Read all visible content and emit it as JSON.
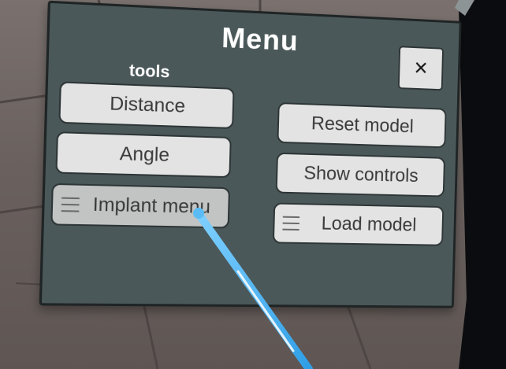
{
  "menu": {
    "title": "Menu",
    "close_label": "✕",
    "tools_label": "tools",
    "left_buttons": [
      {
        "label": "Distance"
      },
      {
        "label": "Angle"
      },
      {
        "label": "Implant menu"
      }
    ],
    "right_buttons": [
      {
        "label": "Reset model"
      },
      {
        "label": "Show controls"
      },
      {
        "label": "Load model"
      }
    ]
  },
  "icons": {
    "submenu": "hamburger-icon",
    "close": "close-icon"
  },
  "colors": {
    "panel_bg": "#4b5859",
    "button_bg": "#e3e3e3",
    "button_hover_bg": "#c2c4c3",
    "pointer_ray": "#3aa8e8"
  }
}
